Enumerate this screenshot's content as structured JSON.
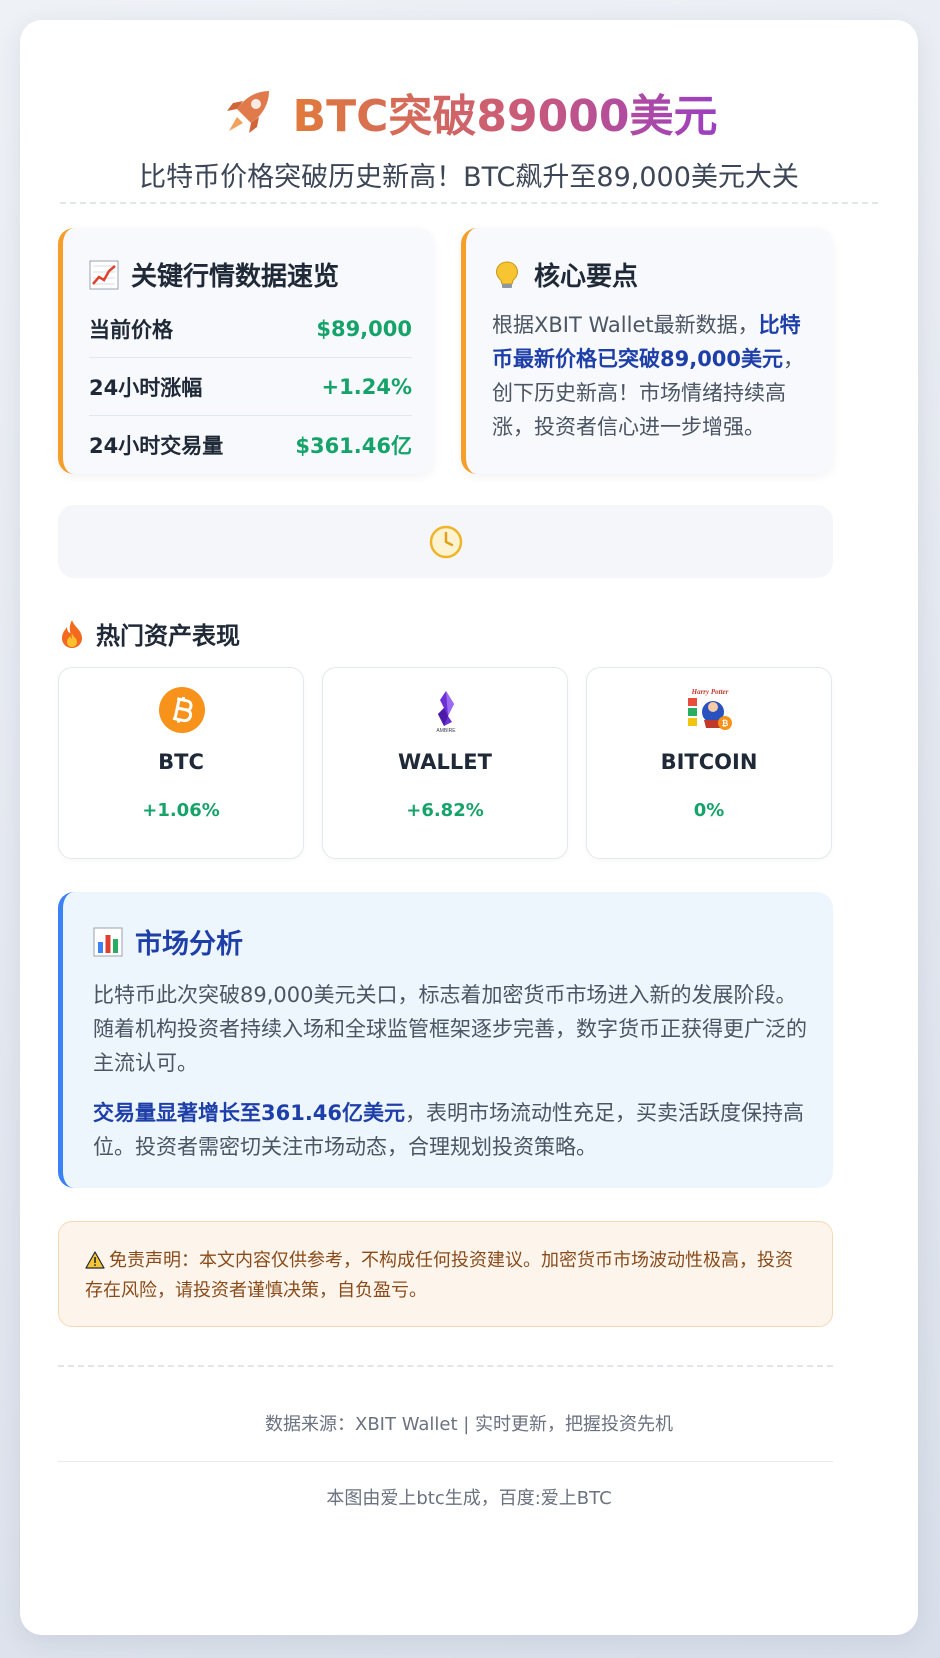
{
  "header": {
    "title": "BTC突破89000美元",
    "subtitle": "比特币价格突破历史新高！BTC飙升至89,000美元大关"
  },
  "market_data": {
    "heading": "关键行情数据速览",
    "rows": [
      {
        "label": "当前价格",
        "value": "$89,000"
      },
      {
        "label": "24小时涨幅",
        "value": "+1.24%"
      },
      {
        "label": "24小时交易量",
        "value": "$361.46亿"
      }
    ]
  },
  "core_points": {
    "heading": "核心要点",
    "text_before": "根据XBIT Wallet最新数据，",
    "text_highlight": "比特币最新价格已突破89,000美元",
    "text_after": "，创下历史新高！市场情绪持续高涨，投资者信心进一步增强。"
  },
  "hot_assets": {
    "heading": "热门资产表现",
    "items": [
      {
        "name": "BTC",
        "change": "+1.06%"
      },
      {
        "name": "WALLET",
        "change": "+6.82%",
        "logo_text": "AMBIRE"
      },
      {
        "name": "BITCOIN",
        "change": "0%",
        "logo_text": "Harry Potter"
      }
    ]
  },
  "analysis": {
    "heading": "市场分析",
    "paragraph1": "比特币此次突破89,000美元关口，标志着加密货币市场进入新的发展阶段。随着机构投资者持续入场和全球监管框架逐步完善，数字货币正获得更广泛的主流认可。",
    "paragraph2_highlight": "交易量显著增长至361.46亿美元",
    "paragraph2_rest": "，表明市场流动性充足，买卖活跃度保持高位。投资者需密切关注市场动态，合理规划投资策略。"
  },
  "disclaimer": {
    "text": "免责声明：本文内容仅供参考，不构成任何投资建议。加密货币市场波动性极高，投资存在风险，请投资者谨慎决策，自负盈亏。"
  },
  "footer": {
    "source": "数据来源：XBIT Wallet | 实时更新，把握投资先机",
    "credit": "本图由爱上btc生成，百度:爱上BTC"
  },
  "colors": {
    "accent_orange": "#f59e2a",
    "accent_blue": "#3b82f6",
    "positive_green": "#16a36a",
    "highlight_blue": "#1e3fa8"
  },
  "icons": {
    "title": "rocket-icon",
    "market_data": "chart-increasing-icon",
    "core_points": "lightbulb-icon",
    "clock": "clock-icon",
    "hot_assets": "fire-icon",
    "analysis": "bar-chart-icon",
    "disclaimer": "warning-icon"
  }
}
